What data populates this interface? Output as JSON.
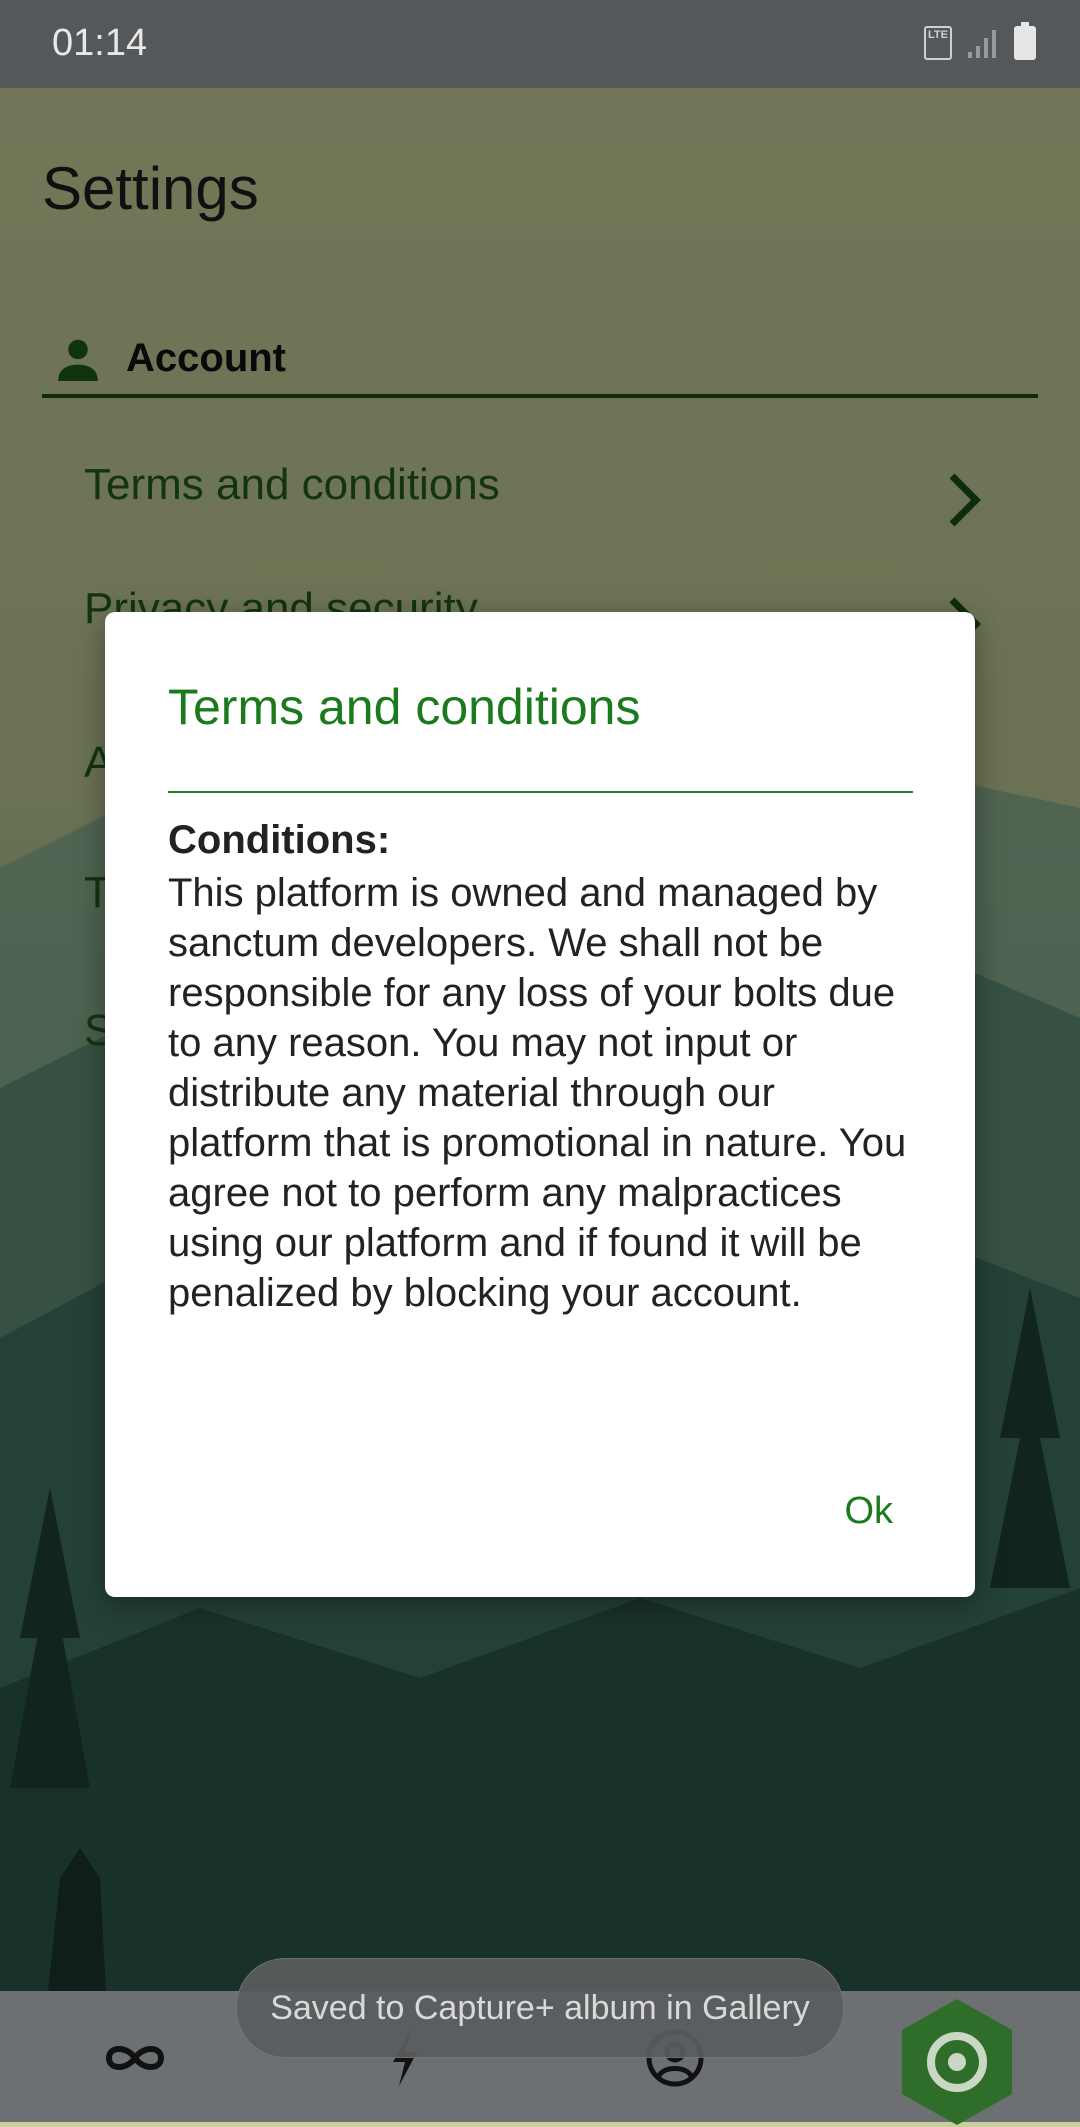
{
  "status_bar": {
    "time": "01:14",
    "network": "LTE"
  },
  "page": {
    "title": "Settings",
    "section": {
      "label": "Account",
      "icon": "person-icon"
    },
    "items": [
      {
        "label": "Terms and conditions"
      },
      {
        "label": "Privacy and security"
      },
      {
        "label": "A"
      },
      {
        "label": "T"
      },
      {
        "label": "S"
      }
    ]
  },
  "dialog": {
    "title": "Terms and conditions",
    "heading": "Conditions:",
    "body": "This platform is owned and managed by sanctum developers. We shall not be responsible for any loss of your bolts due to any reason. You may not input or distribute any material through our platform that is promotional in nature. You agree not to perform any malpractices using our platform and if found it will be penalized by blocking your account.",
    "ok_label": "Ok"
  },
  "toast": "Saved to Capture+ album in Gallery",
  "bottom_nav": [
    {
      "name": "infinity-icon"
    },
    {
      "name": "bolt-icon"
    },
    {
      "name": "profile-icon"
    },
    {
      "name": "settings-target-icon",
      "active": true
    }
  ],
  "colors": {
    "accent": "#1b7a1b",
    "nav_active": "#2f6e2a"
  }
}
